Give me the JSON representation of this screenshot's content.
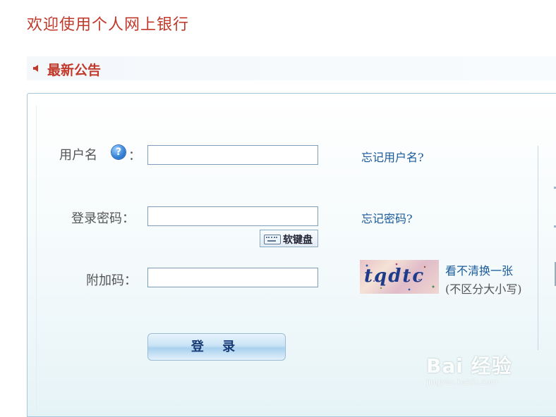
{
  "header": {
    "welcome": "欢迎使用个人网上银行"
  },
  "notice": {
    "title": "最新公告"
  },
  "form": {
    "username_label": "用户名",
    "username_colon": "：",
    "username_help_icon": "question-icon",
    "username_value": "",
    "password_label": "登录密码：",
    "password_value": "",
    "soft_keyboard_label": "软键盘",
    "captcha_label": "附加码：",
    "captcha_value": "",
    "login_button": "登 录"
  },
  "links": {
    "forgot_username": "忘记用户名?",
    "forgot_password": "忘记密码?",
    "refresh_captcha": "看不清换一张",
    "case_note": "(不区分大小写)"
  },
  "captcha_image": {
    "text": "tqdtc"
  },
  "watermark": {
    "logo": "Bai 经验",
    "url": "jingyan.baidu.com"
  },
  "colors": {
    "title_red": "#c0392b",
    "link_blue": "#1a5a9a",
    "border_blue": "#7f9db9"
  }
}
